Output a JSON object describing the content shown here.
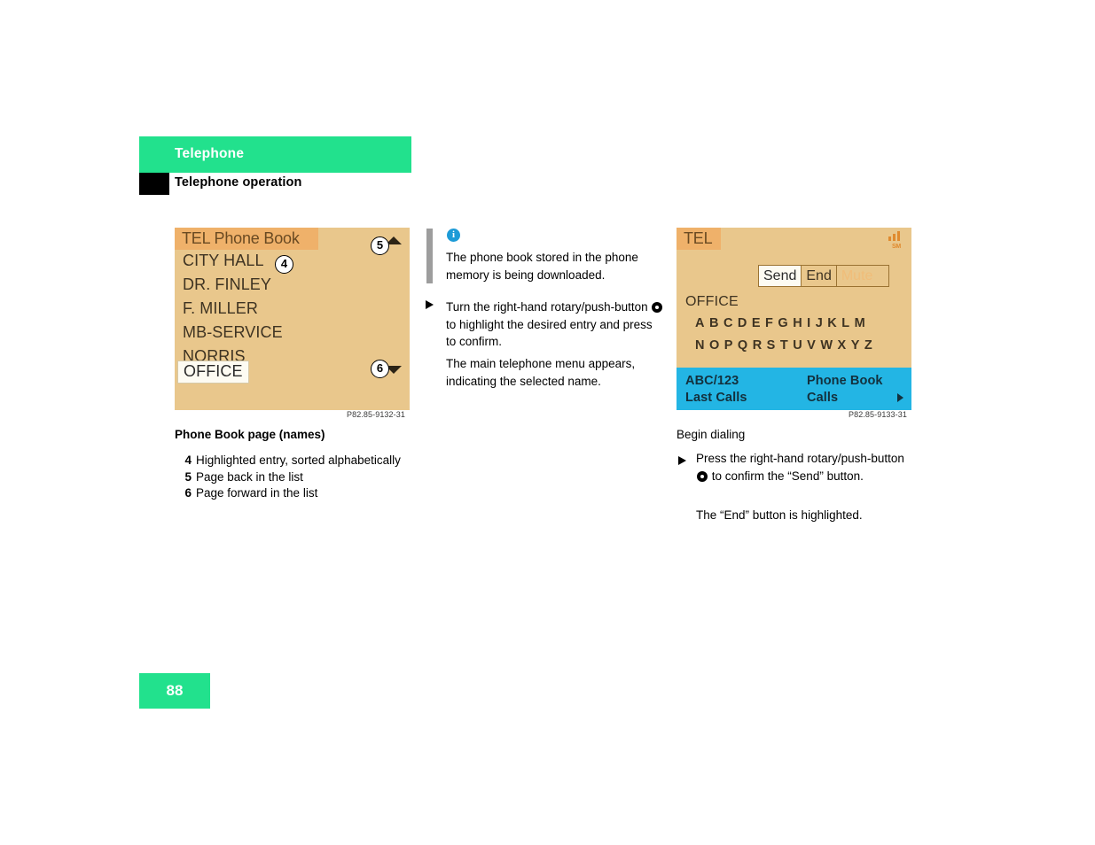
{
  "header": {
    "chapter": "Telephone",
    "section": "Telephone operation"
  },
  "page_number": "88",
  "left_figure": {
    "image_code": "P82.85-9132-31",
    "caption": "Phone Book page (names)",
    "display": {
      "title": "TEL Phone Book",
      "entries": [
        "CITY HALL",
        "DR. FINLEY",
        "F. MILLER",
        "MB-SERVICE",
        "NORRIS",
        "OFFICE"
      ],
      "selected_entry": "OFFICE"
    },
    "callouts": [
      {
        "number": "4",
        "text": "Highlighted entry, sorted alphabetically"
      },
      {
        "number": "5",
        "text": "Page back in the list"
      },
      {
        "number": "6",
        "text": "Page forward in the list"
      }
    ]
  },
  "middle_column": {
    "info_icon": "info-icon",
    "info_text": "The phone book stored in the phone memory is being downloaded.",
    "step_text_pre": "Turn the right-hand rotary/push-button",
    "step_text_post": "to highlight the desired entry and press to confirm.",
    "result_text": "The main telephone menu appears, indicating the selected name."
  },
  "right_figure": {
    "image_code": "P82.85-9133-31",
    "display": {
      "title": "TEL",
      "signal_label": "SM",
      "buttons": [
        {
          "label": "Send",
          "state": "selected"
        },
        {
          "label": "End",
          "state": "normal"
        },
        {
          "label": "Mute",
          "state": "disabled"
        }
      ],
      "name": "OFFICE",
      "alphabet_row1": "ABCDEFGHIJKLM",
      "alphabet_row2": "NOPQRSTUVWXYZ",
      "menu": {
        "top_left": "ABC/123",
        "bottom_left": "Last Calls",
        "top_right": "Phone Book",
        "bottom_right": "Calls"
      }
    },
    "heading": "Begin dialing",
    "step_text_pre": "Press the right-hand rotary/push-button",
    "step_text_post": "to confirm the “Send” button.",
    "result_text": "The “End” button is highlighted."
  }
}
